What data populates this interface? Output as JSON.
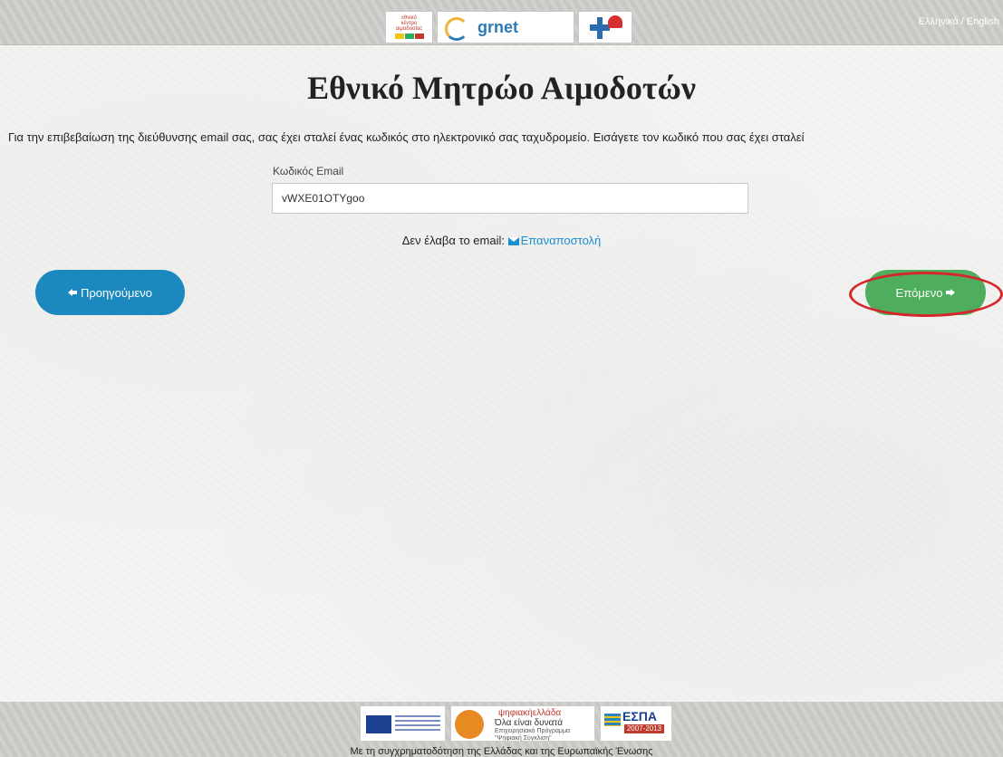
{
  "header": {
    "language_switch": "Ελληνικά / English",
    "logos": [
      {
        "name": "ekea-logo",
        "lines": [
          "εθνικό",
          "κέντρο",
          "αιμοδοσίας"
        ]
      },
      {
        "name": "grnet-logo",
        "text": "grnet"
      },
      {
        "name": "medical-cross-logo"
      }
    ]
  },
  "page": {
    "title": "Εθνικό Μητρώο Αιμοδοτών",
    "instructions": "Για την επιβεβαίωση της διεύθυνσης email σας, σας έχει σταλεί ένας κωδικός στο ηλεκτρονικό σας ταχυδρομείο. Εισάγετε τον κωδικό που σας έχει σταλεί"
  },
  "form": {
    "code_label": "Κωδικός Email",
    "code_value": "vWXE01OTYgoo",
    "resend_prompt": "Δεν έλαβα το email:",
    "resend_link": "Επαναποστολή"
  },
  "navigation": {
    "prev_label": "Προηγούμενο",
    "next_label": "Επόμενο"
  },
  "footer": {
    "digital_logo": {
      "line1": "ψηφιακήελλάδα",
      "line2": "Όλα είναι δυνατά",
      "line3": "Επιχειρησιακό Πρόγραμμα \"Ψηφιακή Σύγκλιση\""
    },
    "espa_logo": {
      "title": "ΕΣΠΑ",
      "years": "2007-2013"
    },
    "cofinance_text": "Με τη συγχρηματοδότηση της Ελλάδας και της Ευρωπαϊκής Ένωσης"
  },
  "colors": {
    "prev_button": "#1b89bf",
    "next_button": "#4fae5d",
    "link": "#1a8fd0",
    "highlight_ring": "#d6252b"
  },
  "icons": [
    "arrow-left-icon",
    "arrow-right-icon",
    "envelope-icon"
  ]
}
